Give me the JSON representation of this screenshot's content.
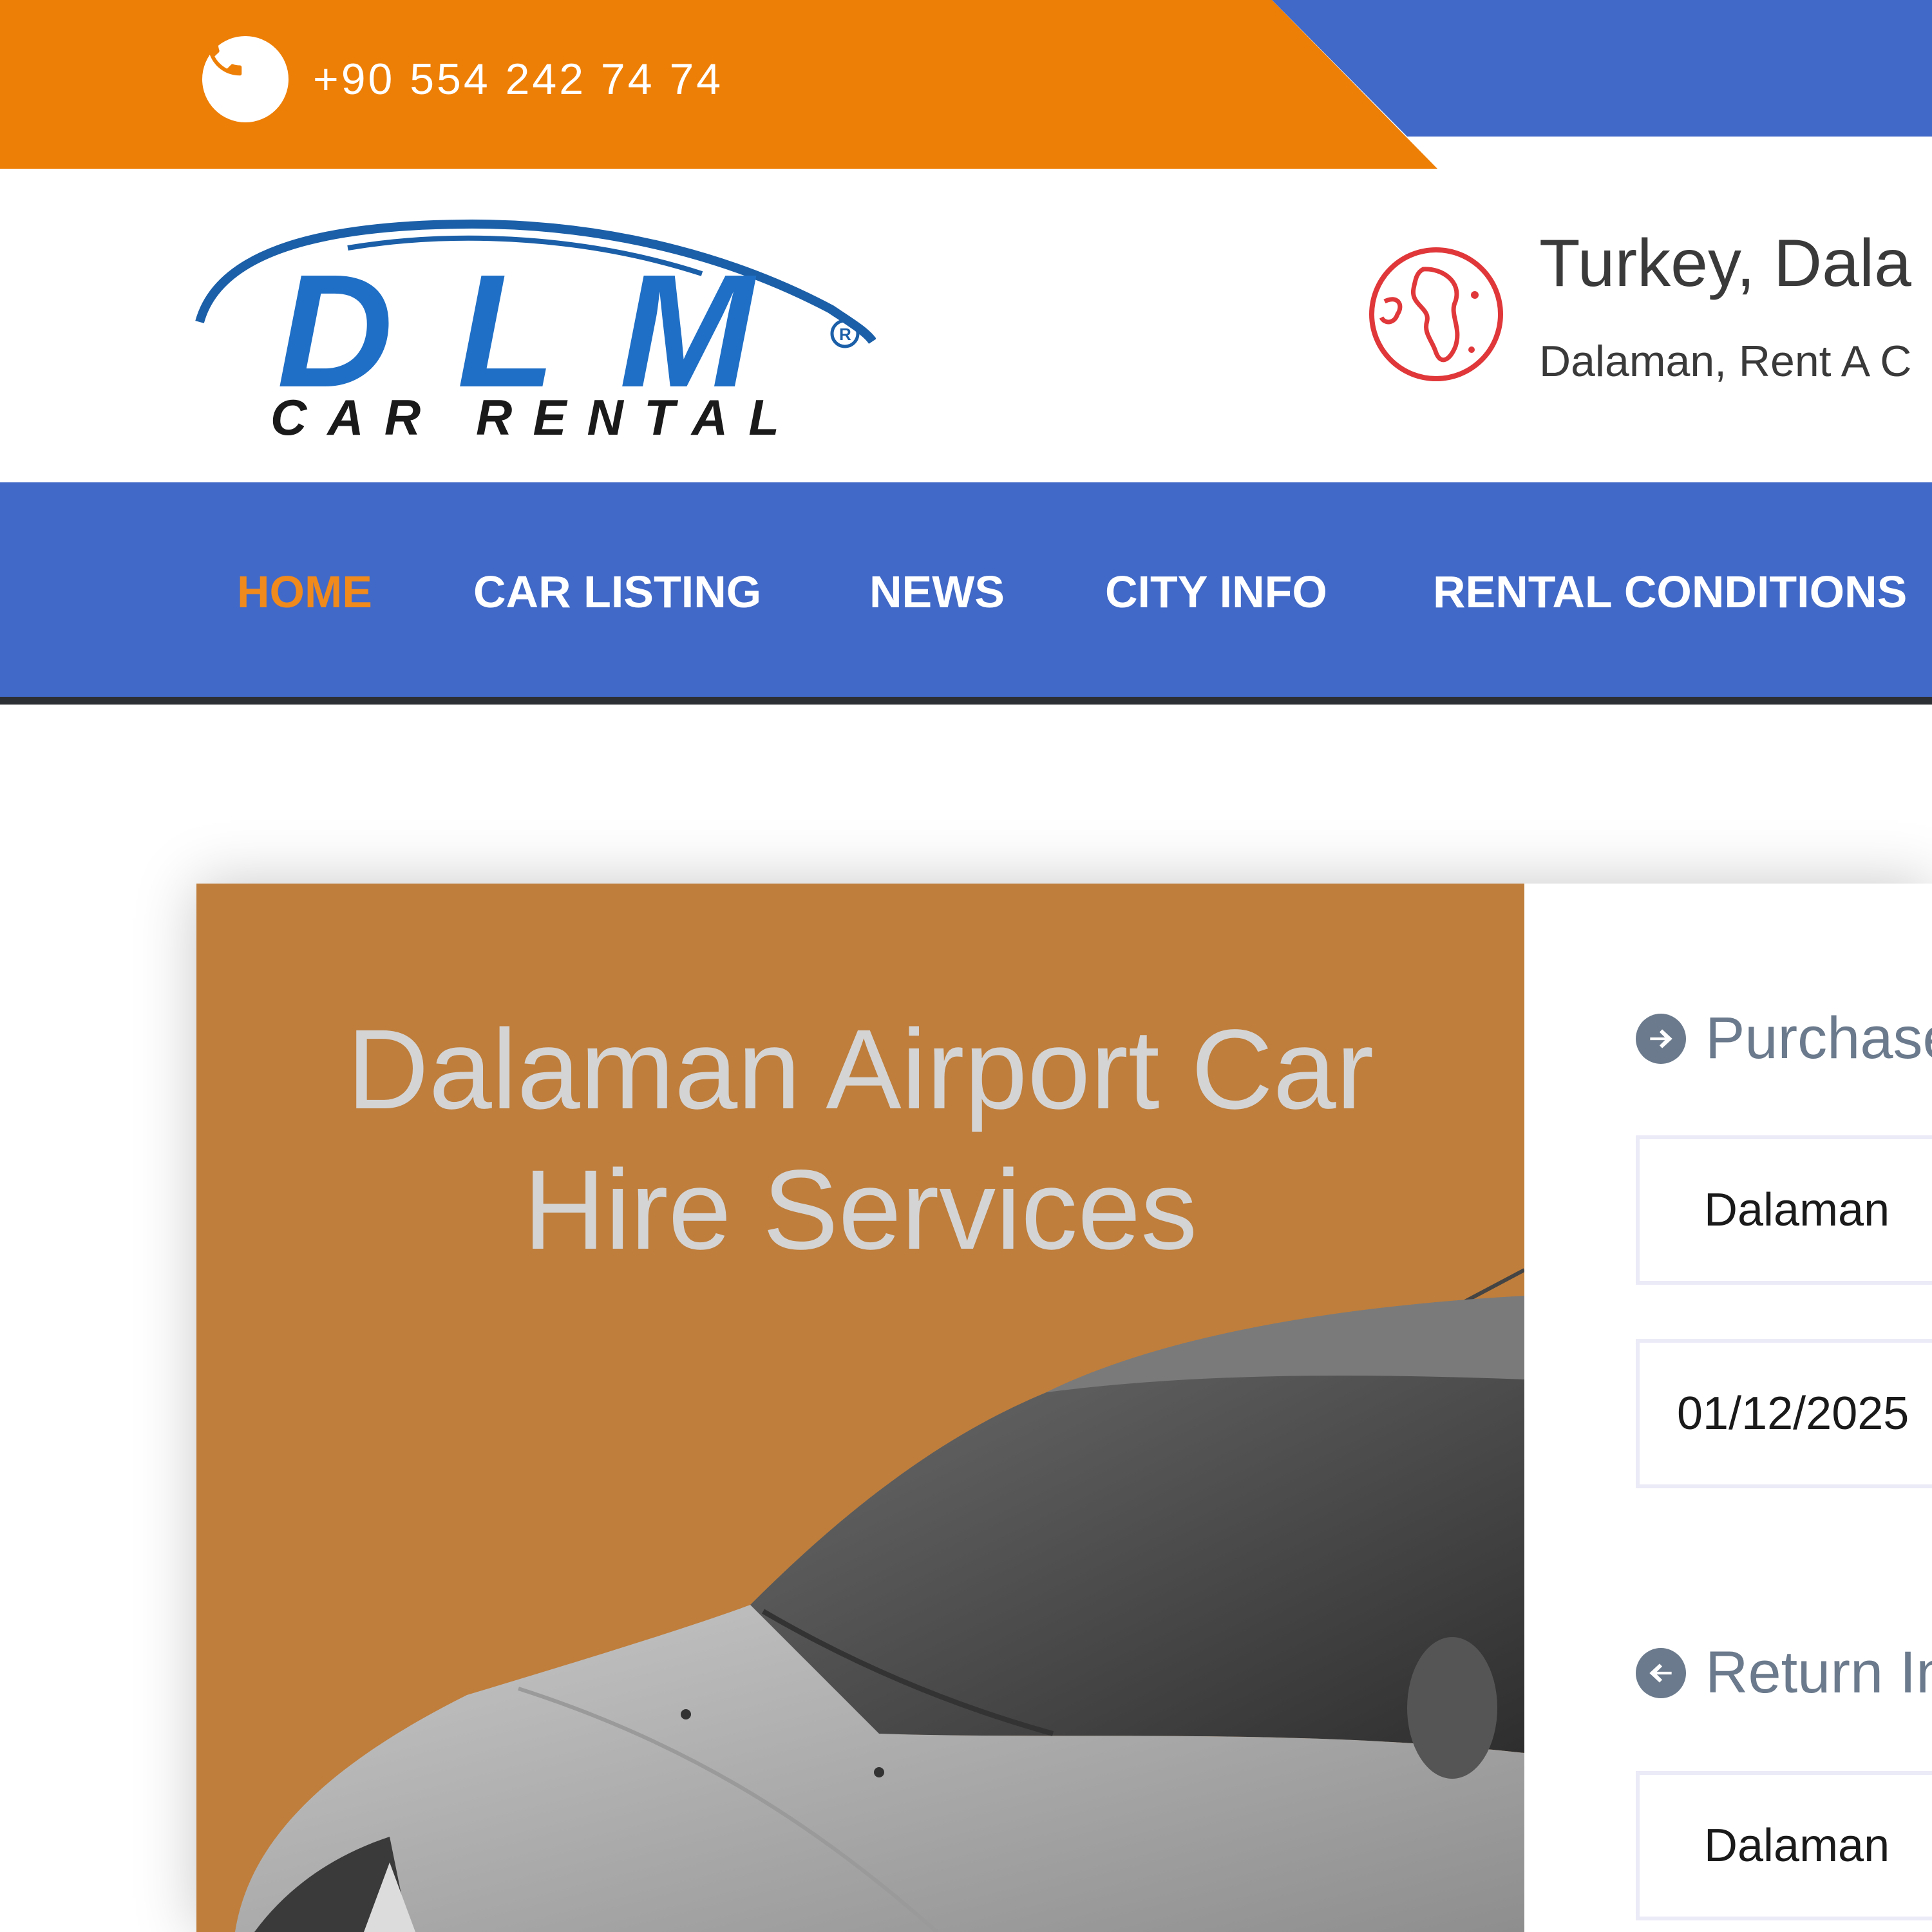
{
  "topbar": {
    "phone": "+90 554 242 74 74",
    "orange_color": "#ee7f06",
    "blue_color": "#4169c7"
  },
  "header": {
    "logo_text": "DLM",
    "logo_subtext": "CAR RENTAL",
    "location_title": "Turkey, Dala",
    "location_sub": "Dalaman, Rent A C"
  },
  "nav": {
    "items": [
      {
        "label": "HOME",
        "active": true
      },
      {
        "label": "CAR LISTING"
      },
      {
        "label": "NEWS"
      },
      {
        "label": "CITY INFO"
      },
      {
        "label": "RENTAL CONDITIONS"
      }
    ]
  },
  "hero": {
    "title_line1": "Dalaman Airport Car",
    "title_line2": "Hire Services",
    "background_color": "#bf7e3c"
  },
  "form": {
    "purchase_heading": "Purchase",
    "purchase_location": "Dalaman",
    "purchase_date": "01/12/2025",
    "return_heading": "Return In",
    "return_location": "Dalaman"
  },
  "icons": [
    "phone-icon",
    "globe-icon",
    "arrow-right-circle-icon",
    "arrow-left-circle-icon"
  ]
}
